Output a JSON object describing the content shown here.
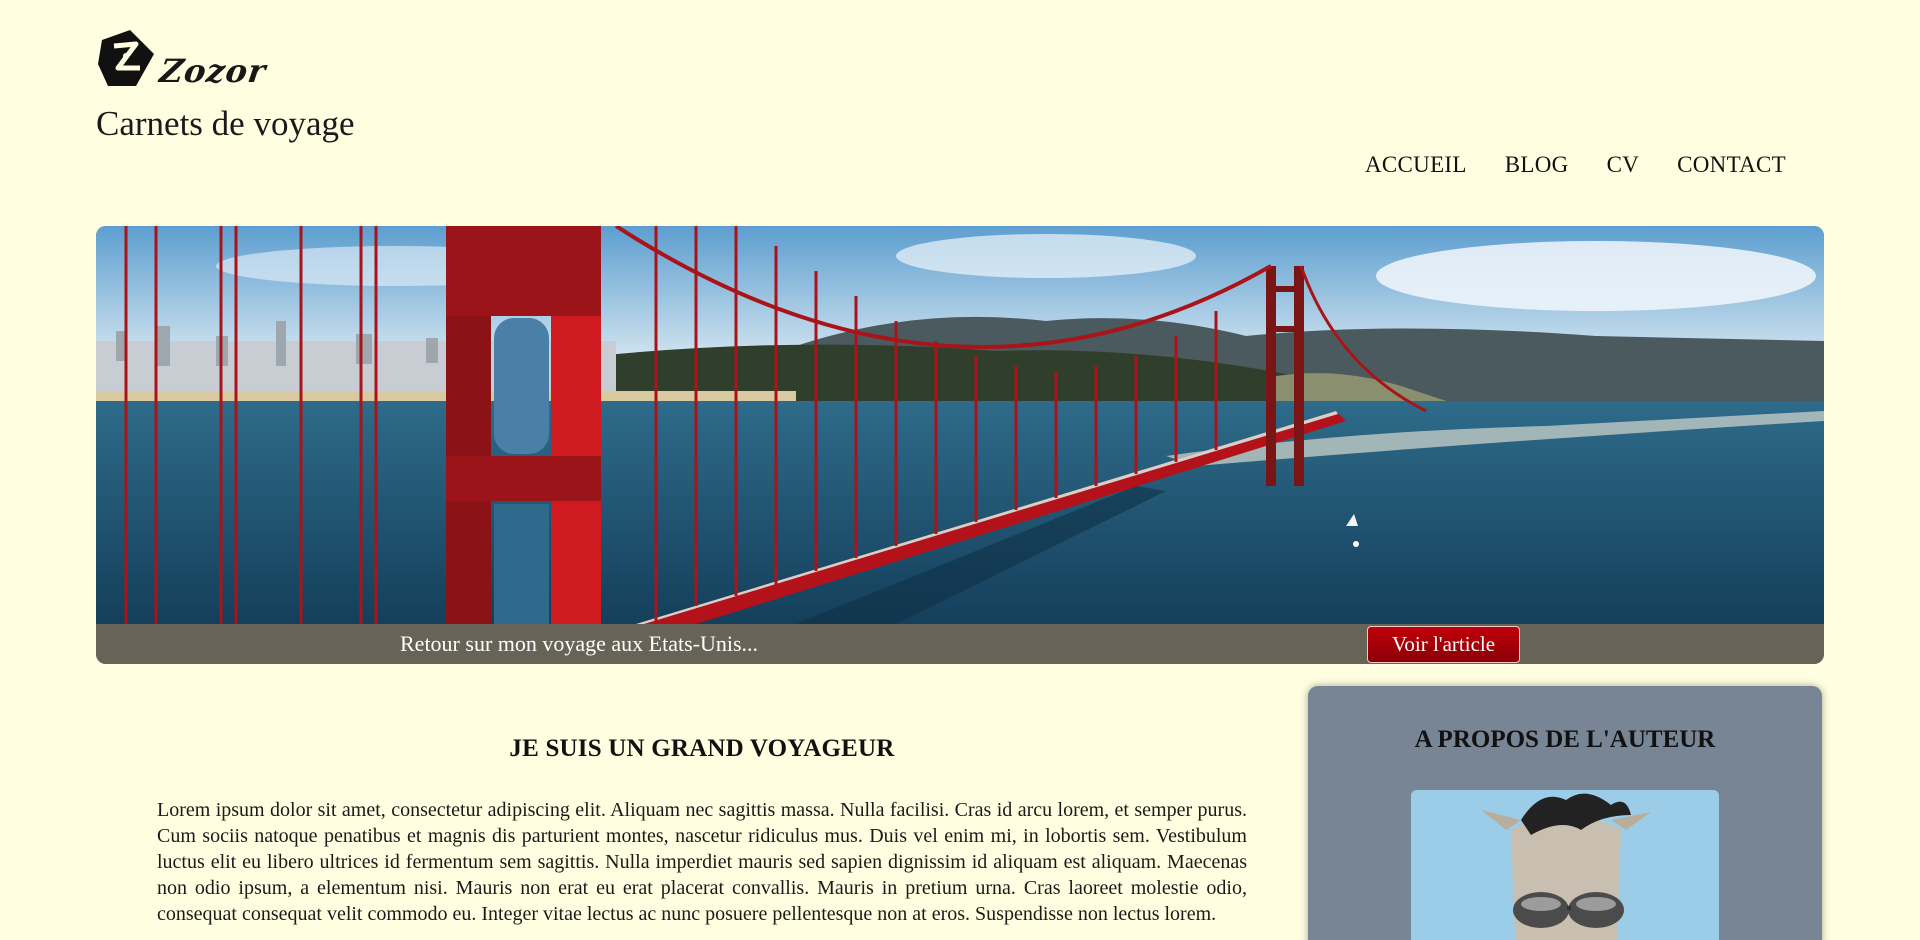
{
  "header": {
    "logo_text": "Zozor",
    "site_title": "Carnets de voyage"
  },
  "nav": {
    "items": [
      "ACCUEIL",
      "BLOG",
      "CV",
      "CONTACT"
    ]
  },
  "banner": {
    "caption": "Retour sur mon voyage aux Etats-Unis...",
    "button_label": "Voir l'article"
  },
  "article": {
    "title": "JE SUIS UN GRAND VOYAGEUR",
    "body": "Lorem ipsum dolor sit amet, consectetur adipiscing elit. Aliquam nec sagittis massa. Nulla facilisi. Cras id arcu lorem, et semper purus. Cum sociis natoque penatibus et magnis dis parturient montes, nascetur ridiculus mus. Duis vel enim mi, in lobortis sem. Vestibulum luctus elit eu libero ultrices id fermentum sem sagittis. Nulla imperdiet mauris sed sapien dignissim id aliquam est aliquam. Maecenas non odio ipsum, a elementum nisi. Mauris non erat eu erat placerat convallis. Mauris in pretium urna. Cras laoreet molestie odio, consequat consequat velit commodo eu. Integer vitae lectus ac nunc posuere pellentesque non at eros. Suspendisse non lectus lorem."
  },
  "sidebar": {
    "title": "A PROPOS DE L'AUTEUR"
  },
  "colors": {
    "background": "#fffee0",
    "banner_bar": "#676457",
    "button_red": "#a80008",
    "sidebar_bg": "#778595",
    "bridge_red": "#c8141c"
  },
  "icons": {
    "logo": "zozor-logo-icon",
    "avatar": "zozor-avatar-icon"
  }
}
